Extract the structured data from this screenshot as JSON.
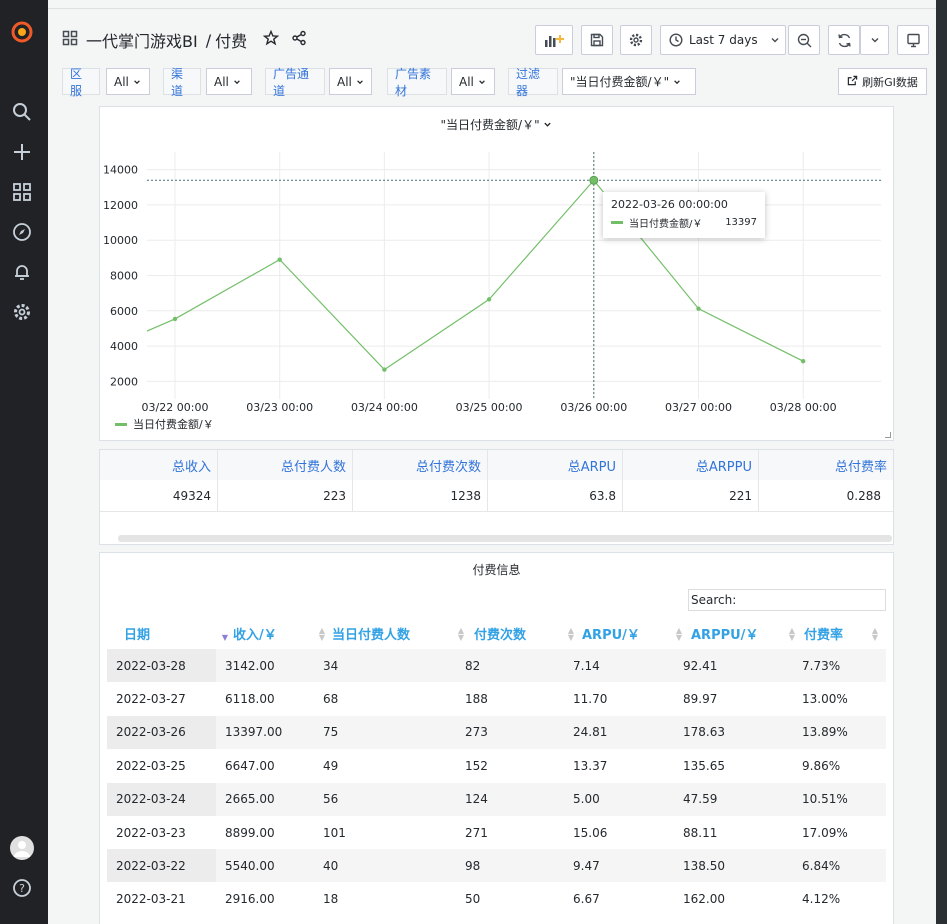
{
  "header": {
    "title": "一代掌门游戏BI",
    "separator": "/",
    "subtitle": "付费",
    "time_range": "Last 7 days"
  },
  "variables": [
    {
      "label": "区服",
      "value": "All"
    },
    {
      "label": "渠道",
      "value": "All"
    },
    {
      "label": "广告通道",
      "value": "All"
    },
    {
      "label": "广告素材",
      "value": "All"
    },
    {
      "label": "过滤器",
      "value": "\"当日付费金额/￥\""
    }
  ],
  "refresh_button": "刷新GI数据",
  "chart_panel": {
    "title": "\"当日付费金额/￥\"",
    "tooltip": {
      "time": "2022-03-26 00:00:00",
      "series": "当日付费金额/￥",
      "value": "13397"
    }
  },
  "chart_data": {
    "type": "line",
    "x": [
      "03/22 00:00",
      "03/23 00:00",
      "03/24 00:00",
      "03/25 00:00",
      "03/26 00:00",
      "03/27 00:00",
      "03/28 00:00"
    ],
    "series": [
      {
        "name": "当日付费金额/￥",
        "values": [
          5540,
          8899,
          2665,
          6647,
          13397,
          6118,
          3142
        ],
        "color": "#73bf69"
      }
    ],
    "left_partial_value": 4850,
    "yticks": [
      "14000",
      "12000",
      "10000",
      "8000",
      "6000",
      "4000",
      "2000"
    ],
    "ylim": [
      1000,
      15000
    ],
    "grid": true,
    "legend": "bottom-left"
  },
  "stats": {
    "headers": [
      "总收入",
      "总付费人数",
      "总付费次数",
      "总ARPU",
      "总ARPPU",
      "总付费率"
    ],
    "values": [
      "49324",
      "223",
      "1238",
      "63.8",
      "221",
      "0.288"
    ]
  },
  "payment_table": {
    "title": "付费信息",
    "search_label": "Search:",
    "headers": [
      "日期",
      "收入/￥",
      "当日付费人数",
      "付费次数",
      "ARPU/￥",
      "ARPPU/￥",
      "付费率"
    ],
    "rows": [
      [
        "2022-03-28",
        "3142.00",
        "34",
        "82",
        "7.14",
        "92.41",
        "7.73%"
      ],
      [
        "2022-03-27",
        "6118.00",
        "68",
        "188",
        "11.70",
        "89.97",
        "13.00%"
      ],
      [
        "2022-03-26",
        "13397.00",
        "75",
        "273",
        "24.81",
        "178.63",
        "13.89%"
      ],
      [
        "2022-03-25",
        "6647.00",
        "49",
        "152",
        "13.37",
        "135.65",
        "9.86%"
      ],
      [
        "2022-03-24",
        "2665.00",
        "56",
        "124",
        "5.00",
        "47.59",
        "10.51%"
      ],
      [
        "2022-03-23",
        "8899.00",
        "101",
        "271",
        "15.06",
        "88.11",
        "17.09%"
      ],
      [
        "2022-03-22",
        "5540.00",
        "40",
        "98",
        "9.47",
        "138.50",
        "6.84%"
      ],
      [
        "2022-03-21",
        "2916.00",
        "18",
        "50",
        "6.67",
        "162.00",
        "4.12%"
      ]
    ]
  }
}
